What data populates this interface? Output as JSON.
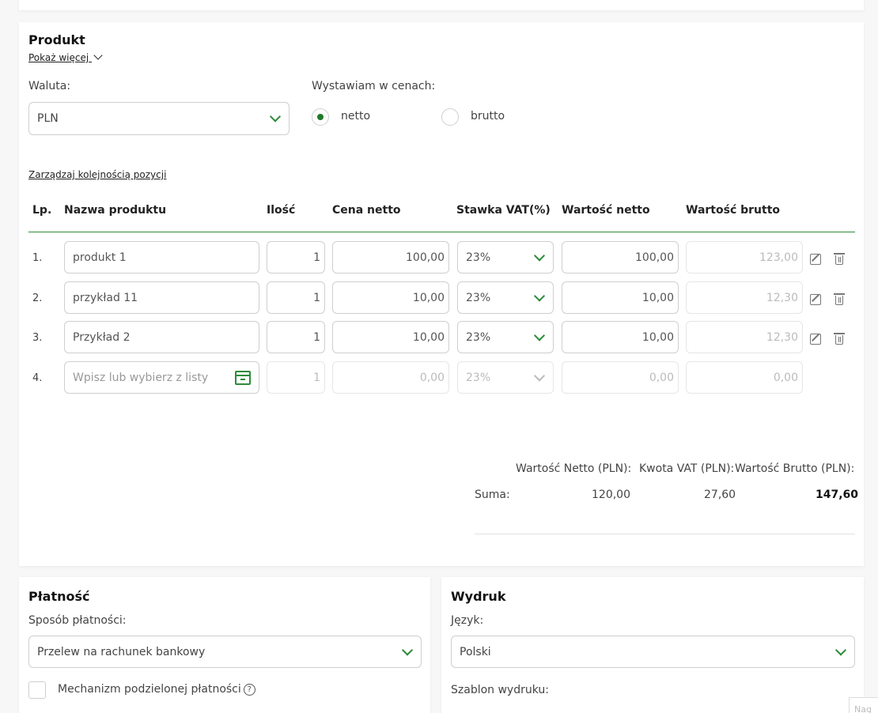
{
  "product": {
    "title": "Produkt",
    "show_more": "Pokaż więcej",
    "currency_label": "Waluta:",
    "currency_value": "PLN",
    "price_mode_label": "Wystawiam w cenach:",
    "price_modes": [
      "netto",
      "brutto"
    ],
    "price_mode_selected": "netto",
    "manage_order": "Zarządzaj kolejnością pozycji",
    "columns": [
      "Lp.",
      "Nazwa produktu",
      "Ilość",
      "Cena netto",
      "Stawka VAT(%)",
      "Wartość netto",
      "Wartość brutto"
    ],
    "rows": [
      {
        "lp": "1.",
        "name": "produkt 1",
        "qty": "1",
        "price": "100,00",
        "vat": "23%",
        "net": "100,00",
        "gross": "123,00"
      },
      {
        "lp": "2.",
        "name": "przykład 11",
        "qty": "1",
        "price": "10,00",
        "vat": "23%",
        "net": "10,00",
        "gross": "12,30"
      },
      {
        "lp": "3.",
        "name": "Przykład 2",
        "qty": "1",
        "price": "10,00",
        "vat": "23%",
        "net": "10,00",
        "gross": "12,30"
      }
    ],
    "new_row": {
      "lp": "4.",
      "placeholder": "Wpisz lub wybierz z listy",
      "qty": "1",
      "price": "0,00",
      "vat": "23%",
      "net": "0,00",
      "gross": "0,00"
    },
    "summary": {
      "net_label": "Wartość Netto (PLN):",
      "vat_label": "Kwota VAT (PLN):",
      "gross_label": "Wartość Brutto (PLN):",
      "sum_label": "Suma:",
      "net_value": "120,00",
      "vat_value": "27,60",
      "gross_value": "147,60"
    }
  },
  "payment": {
    "title": "Płatność",
    "method_label": "Sposób płatności:",
    "method_value": "Przelew na rachunek bankowy",
    "split_payment_label": "Mechanizm podzielonej płatności",
    "help_glyph": "?"
  },
  "print": {
    "title": "Wydruk",
    "language_label": "Język:",
    "language_value": "Polski",
    "template_label": "Szablon wydruku:"
  },
  "corner_text": "Nag",
  "colors": {
    "accent": "#2e8b3a",
    "border": "#cfcfcf"
  }
}
